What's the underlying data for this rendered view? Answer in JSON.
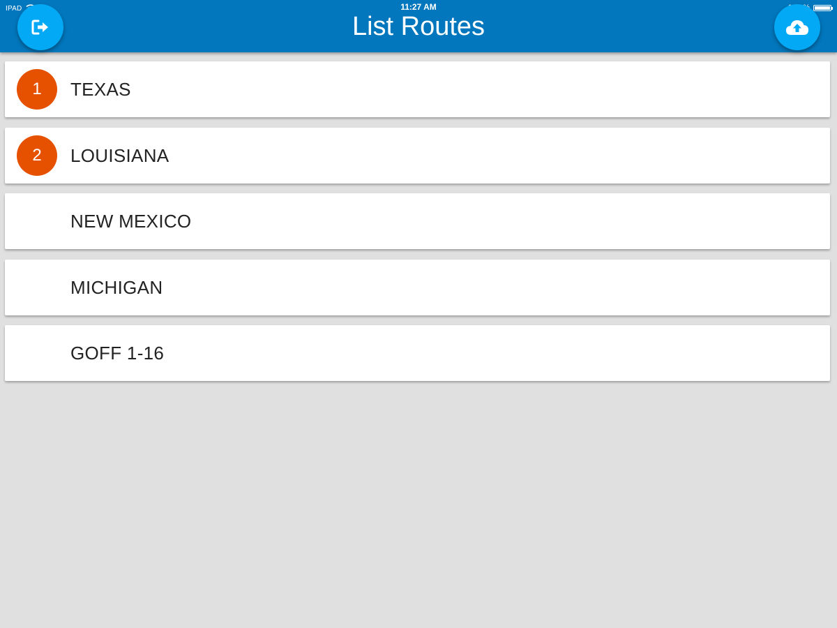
{
  "status_bar": {
    "carrier": "IPAD",
    "time": "11:27 AM",
    "battery": "100 %",
    "battery_level": 1.0
  },
  "header": {
    "title": "List Routes",
    "left_action_icon": "logout-icon",
    "right_action_icon": "cloud-upload-icon"
  },
  "colors": {
    "header_bg": "#0277bd",
    "fab_bg": "#03a9f4",
    "badge_bg": "#e65100",
    "page_bg": "#e0e0e0"
  },
  "routes": [
    {
      "badge": "1",
      "name": "TEXAS"
    },
    {
      "badge": "2",
      "name": "LOUISIANA"
    },
    {
      "badge": "",
      "name": "NEW MEXICO"
    },
    {
      "badge": "",
      "name": "MICHIGAN"
    },
    {
      "badge": "",
      "name": "GOFF 1-16"
    }
  ]
}
